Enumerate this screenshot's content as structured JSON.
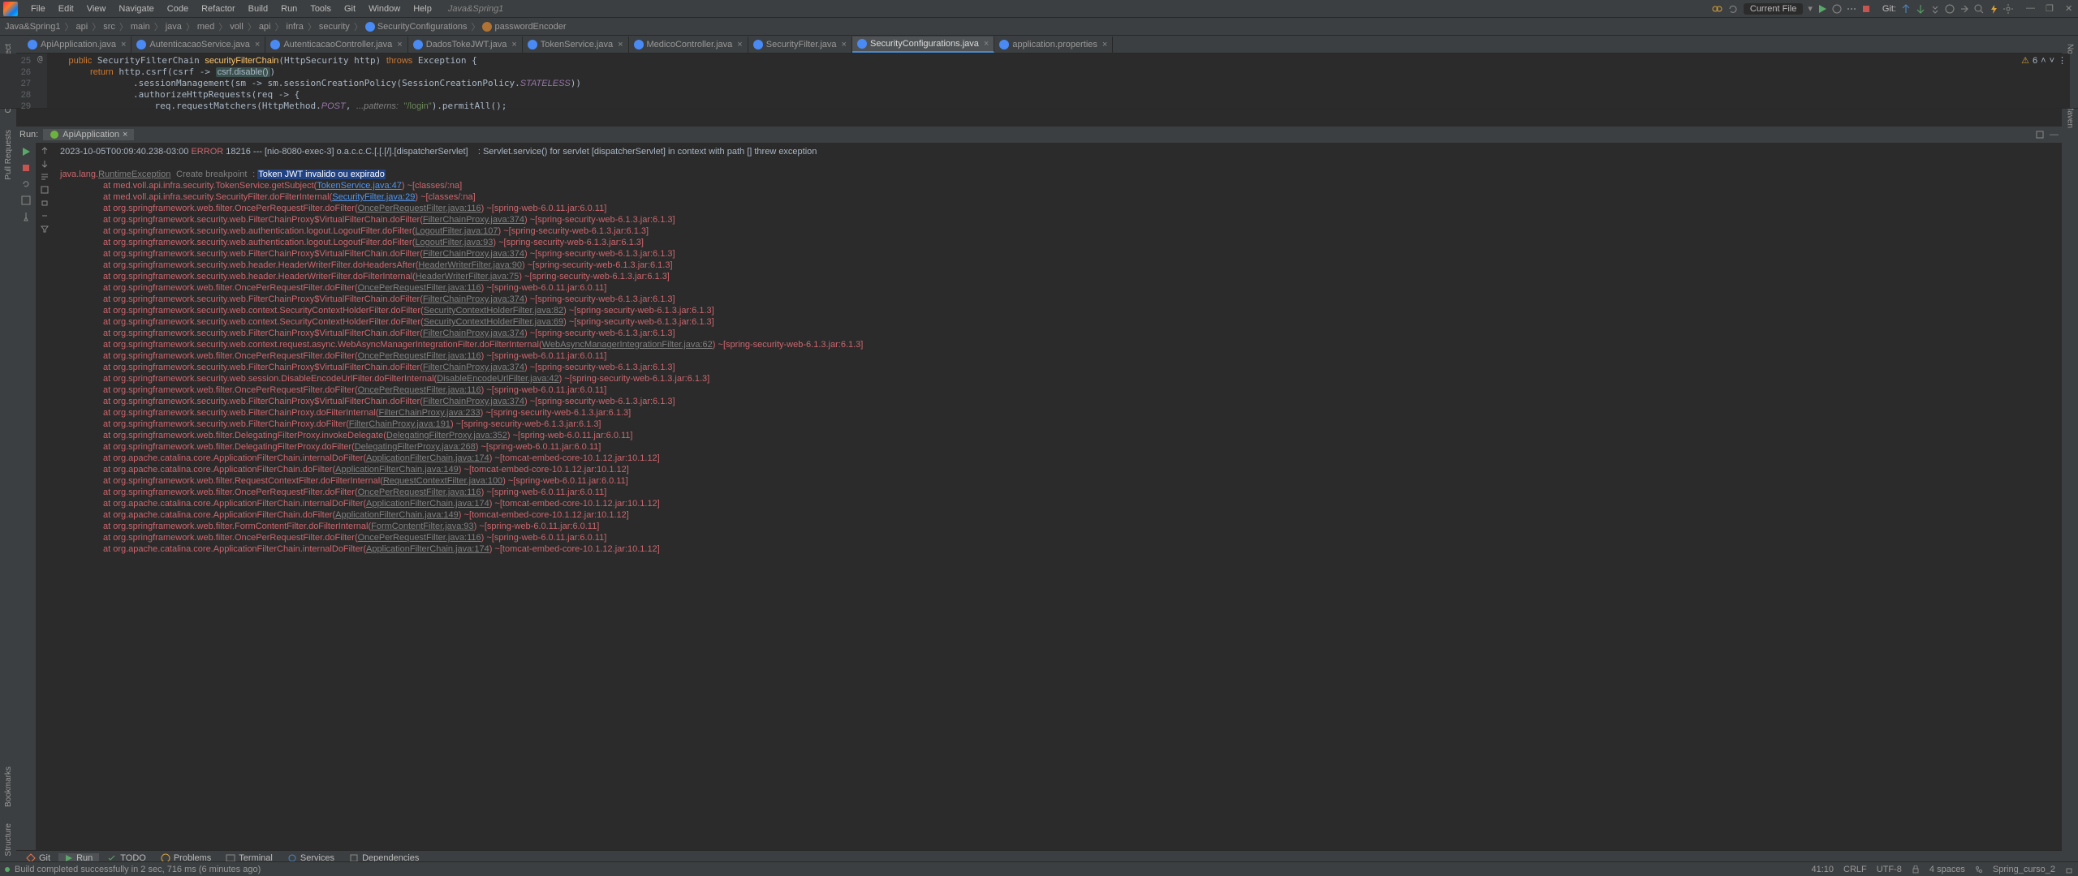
{
  "menu": {
    "items": [
      "File",
      "Edit",
      "View",
      "Navigate",
      "Code",
      "Refactor",
      "Build",
      "Run",
      "Tools",
      "Git",
      "Window",
      "Help"
    ],
    "project": "Java&Spring1"
  },
  "win": {
    "min": "—",
    "restore": "❐",
    "close": "✕"
  },
  "breadcrumb": {
    "parts": [
      "Java&Spring1",
      "api",
      "src",
      "main",
      "java",
      "med",
      "voll",
      "api",
      "infra",
      "security"
    ],
    "class": "SecurityConfigurations",
    "method": "passwordEncoder",
    "run_config": "Current File",
    "git_label": "Git:"
  },
  "tabs": [
    {
      "label": "ApiApplication.java",
      "active": false
    },
    {
      "label": "AutenticacaoService.java",
      "active": false
    },
    {
      "label": "AutenticacaoController.java",
      "active": false
    },
    {
      "label": "DadosTokeJWT.java",
      "active": false
    },
    {
      "label": "TokenService.java",
      "active": false
    },
    {
      "label": "MedicoController.java",
      "active": false
    },
    {
      "label": "SecurityFilter.java",
      "active": false
    },
    {
      "label": "SecurityConfigurations.java",
      "active": true
    },
    {
      "label": "application.properties",
      "active": false,
      "prop": true
    }
  ],
  "gutter": [
    "25",
    "26",
    "27",
    "28",
    "29"
  ],
  "gutter_icon": "@",
  "editor_warn": {
    "icon": "⚠",
    "count": "6",
    "up": "˄",
    "down": "˅",
    "menu": "⋮"
  },
  "run": {
    "label": "Run:",
    "tab": "ApiApplication",
    "close": "×",
    "create_bp": "Create breakpoint",
    "log_head": "2023-10-05T00:09:40.238-03:00 ",
    "log_level": "ERROR",
    "log_rest": " 18216 --- [nio-8080-exec-3] o.a.c.c.C.[.[.[/].[dispatcherServlet]    : Servlet.service() for servlet [dispatcherServlet] in context with path [] threw exception",
    "exception": "java.lang.",
    "exception_type": "RuntimeException",
    "exc_msg": "Token JWT invalido ou expirado",
    "stack": [
      {
        "pre": "\tat med.voll.api.infra.security.TokenService.getSubject(",
        "link": "TokenService.java:47",
        "suf": ") ~[classes/:na]"
      },
      {
        "pre": "\tat med.voll.api.infra.security.SecurityFilter.doFilterInternal(",
        "link": "SecurityFilter.java:29",
        "suf": ") ~[classes/:na]"
      },
      {
        "pre": "\tat org.springframework.web.filter.OncePerRequestFilter.doFilter(",
        "link": "OncePerRequestFilter.java:116",
        "suf": ") ~[spring-web-6.0.11.jar:6.0.11]",
        "gray": true
      },
      {
        "pre": "\tat org.springframework.security.web.FilterChainProxy$VirtualFilterChain.doFilter(",
        "link": "FilterChainProxy.java:374",
        "suf": ") ~[spring-security-web-6.1.3.jar:6.1.3]",
        "gray": true
      },
      {
        "pre": "\tat org.springframework.security.web.authentication.logout.LogoutFilter.doFilter(",
        "link": "LogoutFilter.java:107",
        "suf": ") ~[spring-security-web-6.1.3.jar:6.1.3]",
        "gray": true
      },
      {
        "pre": "\tat org.springframework.security.web.authentication.logout.LogoutFilter.doFilter(",
        "link": "LogoutFilter.java:93",
        "suf": ") ~[spring-security-web-6.1.3.jar:6.1.3]",
        "gray": true
      },
      {
        "pre": "\tat org.springframework.security.web.FilterChainProxy$VirtualFilterChain.doFilter(",
        "link": "FilterChainProxy.java:374",
        "suf": ") ~[spring-security-web-6.1.3.jar:6.1.3]",
        "gray": true
      },
      {
        "pre": "\tat org.springframework.security.web.header.HeaderWriterFilter.doHeadersAfter(",
        "link": "HeaderWriterFilter.java:90",
        "suf": ") ~[spring-security-web-6.1.3.jar:6.1.3]",
        "gray": true
      },
      {
        "pre": "\tat org.springframework.security.web.header.HeaderWriterFilter.doFilterInternal(",
        "link": "HeaderWriterFilter.java:75",
        "suf": ") ~[spring-security-web-6.1.3.jar:6.1.3]",
        "gray": true
      },
      {
        "pre": "\tat org.springframework.web.filter.OncePerRequestFilter.doFilter(",
        "link": "OncePerRequestFilter.java:116",
        "suf": ") ~[spring-web-6.0.11.jar:6.0.11]",
        "gray": true
      },
      {
        "pre": "\tat org.springframework.security.web.FilterChainProxy$VirtualFilterChain.doFilter(",
        "link": "FilterChainProxy.java:374",
        "suf": ") ~[spring-security-web-6.1.3.jar:6.1.3]",
        "gray": true
      },
      {
        "pre": "\tat org.springframework.security.web.context.SecurityContextHolderFilter.doFilter(",
        "link": "SecurityContextHolderFilter.java:82",
        "suf": ") ~[spring-security-web-6.1.3.jar:6.1.3]",
        "gray": true
      },
      {
        "pre": "\tat org.springframework.security.web.context.SecurityContextHolderFilter.doFilter(",
        "link": "SecurityContextHolderFilter.java:69",
        "suf": ") ~[spring-security-web-6.1.3.jar:6.1.3]",
        "gray": true
      },
      {
        "pre": "\tat org.springframework.security.web.FilterChainProxy$VirtualFilterChain.doFilter(",
        "link": "FilterChainProxy.java:374",
        "suf": ") ~[spring-security-web-6.1.3.jar:6.1.3]",
        "gray": true
      },
      {
        "pre": "\tat org.springframework.security.web.context.request.async.WebAsyncManagerIntegrationFilter.doFilterInternal(",
        "link": "WebAsyncManagerIntegrationFilter.java:62",
        "suf": ") ~[spring-security-web-6.1.3.jar:6.1.3]",
        "gray": true
      },
      {
        "pre": "\tat org.springframework.web.filter.OncePerRequestFilter.doFilter(",
        "link": "OncePerRequestFilter.java:116",
        "suf": ") ~[spring-web-6.0.11.jar:6.0.11]",
        "gray": true
      },
      {
        "pre": "\tat org.springframework.security.web.FilterChainProxy$VirtualFilterChain.doFilter(",
        "link": "FilterChainProxy.java:374",
        "suf": ") ~[spring-security-web-6.1.3.jar:6.1.3]",
        "gray": true
      },
      {
        "pre": "\tat org.springframework.security.web.session.DisableEncodeUrlFilter.doFilterInternal(",
        "link": "DisableEncodeUrlFilter.java:42",
        "suf": ") ~[spring-security-web-6.1.3.jar:6.1.3]",
        "gray": true
      },
      {
        "pre": "\tat org.springframework.web.filter.OncePerRequestFilter.doFilter(",
        "link": "OncePerRequestFilter.java:116",
        "suf": ") ~[spring-web-6.0.11.jar:6.0.11]",
        "gray": true
      },
      {
        "pre": "\tat org.springframework.security.web.FilterChainProxy$VirtualFilterChain.doFilter(",
        "link": "FilterChainProxy.java:374",
        "suf": ") ~[spring-security-web-6.1.3.jar:6.1.3]",
        "gray": true
      },
      {
        "pre": "\tat org.springframework.security.web.FilterChainProxy.doFilterInternal(",
        "link": "FilterChainProxy.java:233",
        "suf": ") ~[spring-security-web-6.1.3.jar:6.1.3]",
        "gray": true
      },
      {
        "pre": "\tat org.springframework.security.web.FilterChainProxy.doFilter(",
        "link": "FilterChainProxy.java:191",
        "suf": ") ~[spring-security-web-6.1.3.jar:6.1.3]",
        "gray": true
      },
      {
        "pre": "\tat org.springframework.web.filter.DelegatingFilterProxy.invokeDelegate(",
        "link": "DelegatingFilterProxy.java:352",
        "suf": ") ~[spring-web-6.0.11.jar:6.0.11]",
        "gray": true
      },
      {
        "pre": "\tat org.springframework.web.filter.DelegatingFilterProxy.doFilter(",
        "link": "DelegatingFilterProxy.java:268",
        "suf": ") ~[spring-web-6.0.11.jar:6.0.11]",
        "gray": true
      },
      {
        "pre": "\tat org.apache.catalina.core.ApplicationFilterChain.internalDoFilter(",
        "link": "ApplicationFilterChain.java:174",
        "suf": ") ~[tomcat-embed-core-10.1.12.jar:10.1.12]",
        "gray": true
      },
      {
        "pre": "\tat org.apache.catalina.core.ApplicationFilterChain.doFilter(",
        "link": "ApplicationFilterChain.java:149",
        "suf": ") ~[tomcat-embed-core-10.1.12.jar:10.1.12]",
        "gray": true
      },
      {
        "pre": "\tat org.springframework.web.filter.RequestContextFilter.doFilterInternal(",
        "link": "RequestContextFilter.java:100",
        "suf": ") ~[spring-web-6.0.11.jar:6.0.11]",
        "gray": true
      },
      {
        "pre": "\tat org.springframework.web.filter.OncePerRequestFilter.doFilter(",
        "link": "OncePerRequestFilter.java:116",
        "suf": ") ~[spring-web-6.0.11.jar:6.0.11]",
        "gray": true
      },
      {
        "pre": "\tat org.apache.catalina.core.ApplicationFilterChain.internalDoFilter(",
        "link": "ApplicationFilterChain.java:174",
        "suf": ") ~[tomcat-embed-core-10.1.12.jar:10.1.12]",
        "gray": true
      },
      {
        "pre": "\tat org.apache.catalina.core.ApplicationFilterChain.doFilter(",
        "link": "ApplicationFilterChain.java:149",
        "suf": ") ~[tomcat-embed-core-10.1.12.jar:10.1.12]",
        "gray": true
      },
      {
        "pre": "\tat org.springframework.web.filter.FormContentFilter.doFilterInternal(",
        "link": "FormContentFilter.java:93",
        "suf": ") ~[spring-web-6.0.11.jar:6.0.11]",
        "gray": true
      },
      {
        "pre": "\tat org.springframework.web.filter.OncePerRequestFilter.doFilter(",
        "link": "OncePerRequestFilter.java:116",
        "suf": ") ~[spring-web-6.0.11.jar:6.0.11]",
        "gray": true
      },
      {
        "pre": "\tat org.apache.catalina.core.ApplicationFilterChain.internalDoFilter(",
        "link": "ApplicationFilterChain.java:174",
        "suf": ") ~[tomcat-embed-core-10.1.12.jar:10.1.12]",
        "gray": true
      }
    ]
  },
  "bottom": {
    "git": "Git",
    "run": "Run",
    "todo": "TODO",
    "problems": "Problems",
    "terminal": "Terminal",
    "services": "Services",
    "dependencies": "Dependencies"
  },
  "status": {
    "msg": "Build completed successfully in 2 sec, 716 ms (6 minutes ago)",
    "pos": "41:10",
    "sep": "CRLF",
    "enc": "UTF-8",
    "indent": "4 spaces",
    "branch": "Spring_curso_2"
  },
  "left_stripe": {
    "project": "Project",
    "commit": "Commit",
    "pr": "Pull Requests",
    "bookmarks": "Bookmarks",
    "structure": "Structure"
  },
  "right_stripe": {
    "notif": "Notifications",
    "maven": "Maven"
  }
}
